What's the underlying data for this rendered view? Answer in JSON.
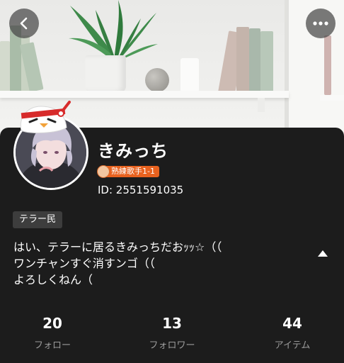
{
  "header": {
    "back_icon": "chevron-left-icon",
    "more_icon": "more-horizontal-icon"
  },
  "profile": {
    "nickname": "きみっち",
    "rank_badge": "熟練歌手1-1",
    "user_id": "ID: 2551591035",
    "tag": "テラー民",
    "bio_lines": [
      "はい、テラーに居るきみっちだおｯｯ☆（（",
      "ワンチャンすぐ消すンゴ（（",
      "よろしくねん（"
    ]
  },
  "stats": [
    {
      "value": "20",
      "label": "フォロー"
    },
    {
      "value": "13",
      "label": "フォロワー"
    },
    {
      "value": "44",
      "label": "アイテム"
    }
  ],
  "colors": {
    "background": "#1c1c1c",
    "badge_orange": "#e8621f",
    "chip": "#3d3d3d",
    "muted_text": "#9a9a9a"
  }
}
